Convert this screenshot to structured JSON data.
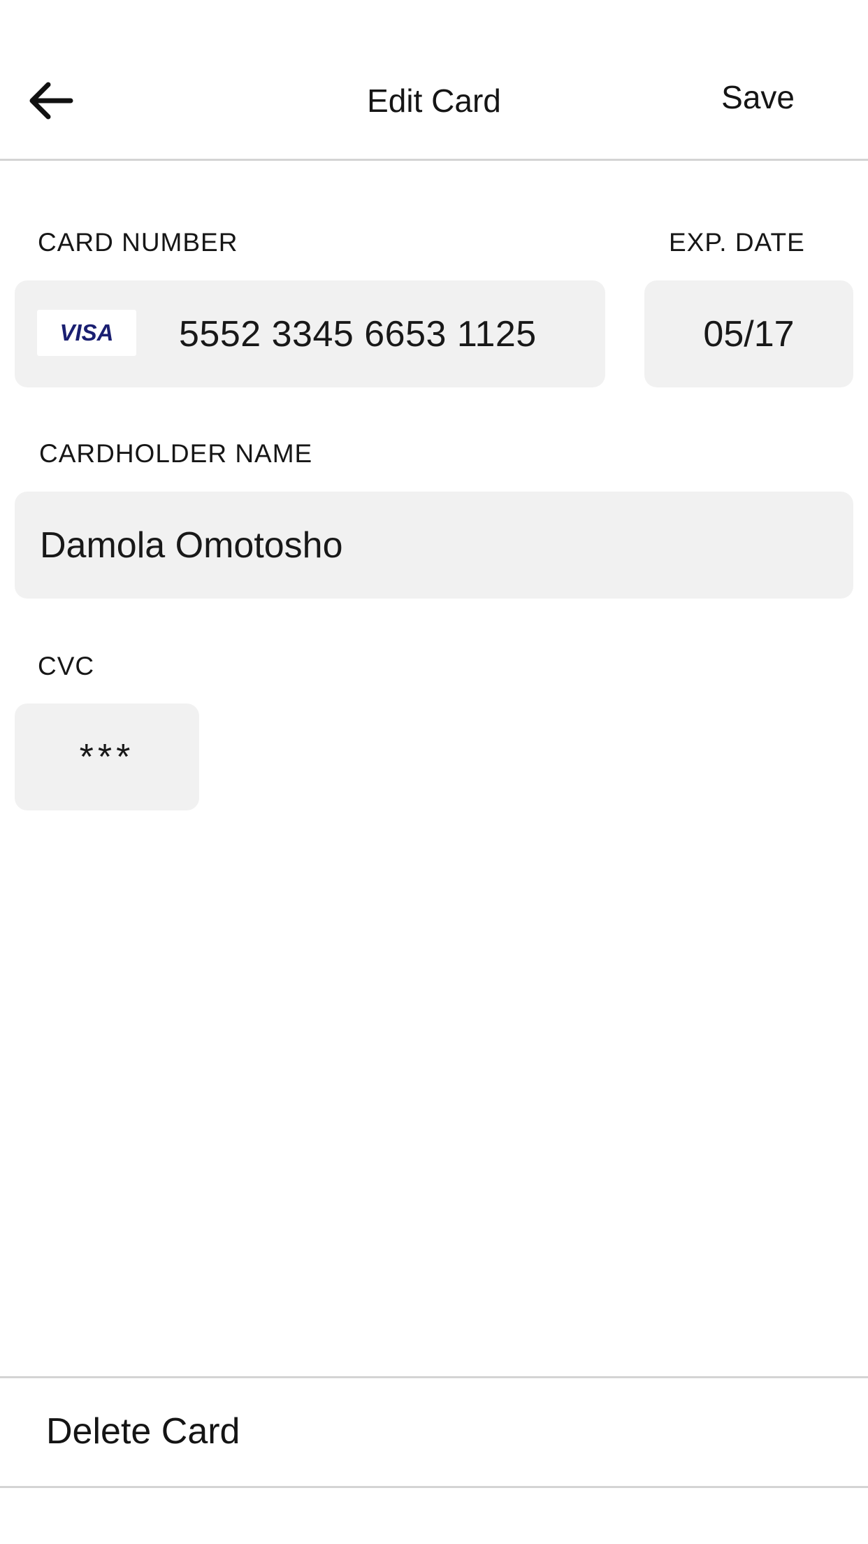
{
  "header": {
    "title": "Edit Card",
    "save_label": "Save",
    "back_icon": "arrow-left-icon"
  },
  "form": {
    "card_number_label": "CARD NUMBER",
    "card_number_value": "5552 3345 6653 1125",
    "card_brand": "VISA",
    "card_brand_color": "#1a1f71",
    "exp_date_label": "EXP. DATE",
    "exp_date_value": "05/17",
    "cardholder_label": "CARDHOLDER NAME",
    "cardholder_value": "Damola Omotosho",
    "cvc_label": "CVC",
    "cvc_value": "***"
  },
  "footer": {
    "delete_label": "Delete Card"
  },
  "colors": {
    "field_background": "#f1f1f1",
    "divider": "#d4d4d4",
    "text": "#151515"
  }
}
